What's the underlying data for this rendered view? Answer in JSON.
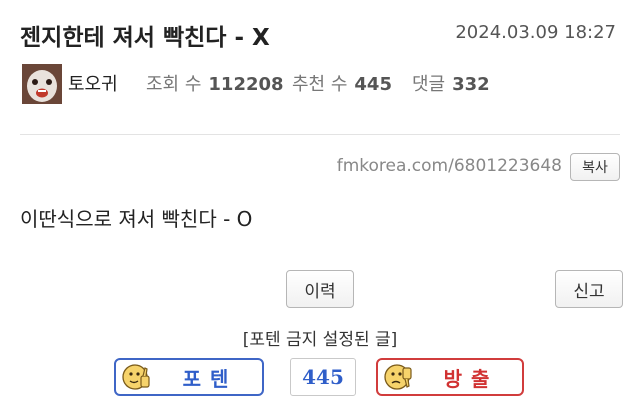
{
  "post": {
    "title": "젠지한테 져서 빡친다 - X",
    "date": "2024.03.09 18:27",
    "author": "토오귀",
    "views_label": "조회 수",
    "views": "112208",
    "votes_label": "추천 수",
    "votes": "445",
    "comments_label": "댓글",
    "comments": "332",
    "url": "fmkorea.com/6801223648",
    "body": "이딴식으로 져서 빡친다 - O"
  },
  "actions": {
    "copy_label": "복사",
    "history_label": "이력",
    "report_label": "신고",
    "vote_notice": "[포텐 금지 설정된 글]",
    "upvote_label": "포텐",
    "downvote_label": "방출",
    "vote_count": "445"
  },
  "icons": {
    "avatar": "author-avatar",
    "upvote": "thumbs-up-face-icon",
    "downvote": "thumbs-down-face-icon"
  },
  "colors": {
    "upvote": "#3f66c6",
    "downvote": "#d13c3c"
  }
}
